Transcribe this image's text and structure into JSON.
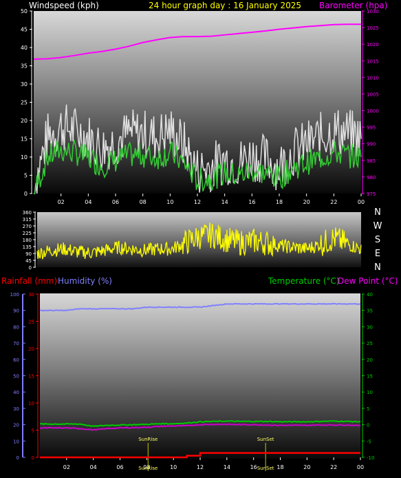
{
  "header": {
    "windspeed_label": "Windspeed (kph)",
    "graph_title": "24 hour graph day : 16 January 2025",
    "barometer_label": "Barometer (hpa)"
  },
  "lower_header": {
    "rainfall_label": "Rainfall (mm)",
    "humidity_label": "Humidity (%)",
    "temperature_label": "Temperature (°C)",
    "dewpoint_label": "Dew Point (°C)"
  },
  "time_ticks": [
    "02",
    "04",
    "06",
    "08",
    "10",
    "12",
    "14",
    "16",
    "18",
    "20",
    "22",
    "00"
  ],
  "compass": [
    "N",
    "W",
    "S",
    "E",
    "N"
  ],
  "sun_markers": {
    "sunrise": "SunRise",
    "sunset": "SunSet"
  },
  "colors": {
    "windspeed_gust": "#e0e0e0",
    "windspeed_avg": "#33cc33",
    "barometer": "#ff00ff",
    "direction": "#ffff00",
    "rainfall": "#ff0000",
    "humidity": "#8080ff",
    "temperature": "#00cc00",
    "dewpoint": "#cc00cc",
    "title": "#ffff00"
  },
  "chart_data": [
    {
      "type": "line",
      "title": "24 hour graph day : 16 January 2025",
      "ylabel": "Windspeed (kph)",
      "y2label": "Barometer (hpa)",
      "ylim": [
        0,
        50
      ],
      "y2lim": [
        975,
        1030
      ],
      "yticks": [
        0,
        5,
        10,
        15,
        20,
        25,
        30,
        35,
        40,
        45,
        50
      ],
      "y2ticks": [
        975,
        980,
        985,
        990,
        995,
        1000,
        1005,
        1010,
        1015,
        1020,
        1025,
        1030
      ],
      "x_hours": [
        0,
        1,
        2,
        3,
        4,
        5,
        6,
        7,
        8,
        9,
        10,
        11,
        12,
        13,
        14,
        15,
        16,
        17,
        18,
        19,
        20,
        21,
        22,
        23,
        24
      ],
      "series": [
        {
          "name": "Windspeed (kph)",
          "values": [
            0,
            14,
            17,
            16,
            14,
            11,
            13,
            15,
            15,
            14,
            16,
            12,
            5,
            6,
            8,
            7,
            9,
            8,
            6,
            10,
            12,
            14,
            16,
            15,
            14
          ]
        },
        {
          "name": "Barometer (hpa)",
          "axis": "right",
          "values": [
            1015.5,
            1015.6,
            1016,
            1016.6,
            1017.3,
            1017.8,
            1018.5,
            1019.4,
            1020.5,
            1021.3,
            1022,
            1022.3,
            1022.3,
            1022.4,
            1022.8,
            1023.2,
            1023.6,
            1024,
            1024.5,
            1024.9,
            1025.3,
            1025.6,
            1025.9,
            1026,
            1026
          ]
        }
      ]
    },
    {
      "type": "line",
      "ylabel": "Wind direction",
      "ylim": [
        0,
        360
      ],
      "yticks": [
        0,
        45,
        90,
        135,
        180,
        225,
        270,
        315,
        360
      ],
      "right_labels": [
        "N",
        "W",
        "S",
        "E",
        "N"
      ],
      "x_hours": [
        0,
        1,
        2,
        3,
        4,
        5,
        6,
        7,
        8,
        9,
        10,
        11,
        12,
        13,
        14,
        15,
        16,
        17,
        18,
        19,
        20,
        21,
        22,
        23,
        24
      ],
      "series": [
        {
          "name": "Wind direction",
          "values": [
            90,
            110,
            120,
            100,
            95,
            110,
            130,
            120,
            110,
            120,
            120,
            160,
            200,
            210,
            180,
            160,
            170,
            160,
            140,
            130,
            120,
            150,
            190,
            150,
            120
          ]
        }
      ]
    },
    {
      "type": "line",
      "ylim": [
        0,
        30
      ],
      "yticks_rain": [
        0,
        5,
        10,
        15,
        20,
        25,
        30
      ],
      "yticks_humidity": [
        0,
        10,
        20,
        30,
        40,
        50,
        60,
        70,
        80,
        90,
        100
      ],
      "yticks_temp": [
        -10,
        -5,
        0,
        5,
        10,
        15,
        20,
        25,
        30,
        35,
        40
      ],
      "x_hours": [
        0,
        1,
        2,
        3,
        4,
        5,
        6,
        7,
        8,
        9,
        10,
        11,
        12,
        13,
        14,
        15,
        16,
        17,
        18,
        19,
        20,
        21,
        22,
        23,
        24
      ],
      "series": [
        {
          "name": "Rainfall (mm)",
          "axis": "rain",
          "values": [
            0,
            0,
            0,
            0,
            0,
            0,
            0,
            0,
            0,
            0,
            0,
            0.3,
            0.8,
            0.8,
            0.8,
            0.8,
            0.8,
            0.8,
            0.8,
            0.8,
            0.8,
            0.8,
            0.8,
            0.8,
            0.8
          ]
        },
        {
          "name": "Humidity (%)",
          "axis": "humidity",
          "values": [
            90,
            90,
            90,
            91,
            91,
            91,
            91,
            91,
            92,
            92,
            92,
            92,
            92,
            93,
            94,
            94,
            94,
            94,
            94,
            94,
            94,
            94,
            94,
            94,
            94
          ]
        },
        {
          "name": "Temperature (°C)",
          "axis": "temp",
          "values": [
            0.2,
            0.2,
            0.2,
            0.2,
            -0.5,
            -0.2,
            -0.1,
            0,
            0.1,
            0.3,
            0.3,
            0.5,
            0.9,
            1,
            1.1,
            1,
            1,
            1,
            0.9,
            0.9,
            0.9,
            1,
            1.1,
            1,
            0.9
          ]
        },
        {
          "name": "Dew Point (°C)",
          "axis": "temp",
          "values": [
            -1,
            -1,
            -1,
            -1.2,
            -1.6,
            -1.2,
            -1,
            -0.9,
            -0.8,
            -0.5,
            -0.4,
            -0.3,
            0,
            0.1,
            0.1,
            0,
            0,
            -0.1,
            -0.2,
            -0.2,
            -0.2,
            -0.1,
            -0.1,
            -0.1,
            -0.3
          ]
        }
      ],
      "sunrise_hour": 8.1,
      "sunset_hour": 16.9
    }
  ]
}
